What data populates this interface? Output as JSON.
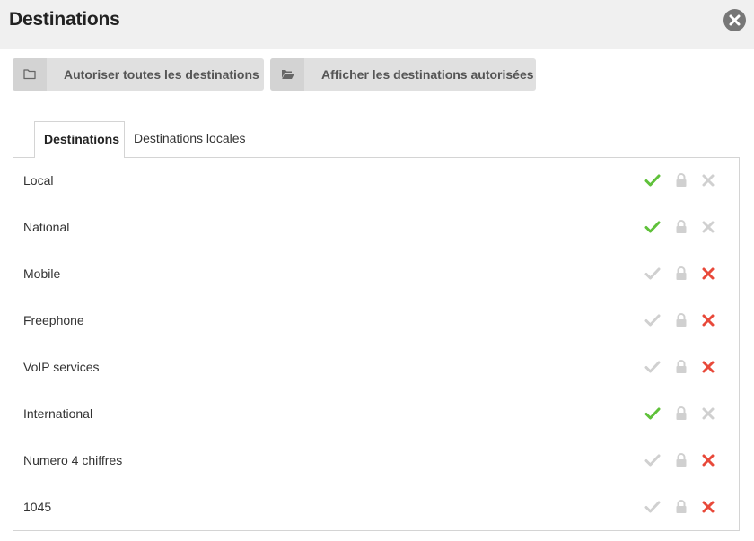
{
  "header": {
    "title": "Destinations"
  },
  "toolbar": {
    "allow_all_label": "Autoriser toutes les destinations",
    "show_allowed_label": "Afficher les destinations autorisées"
  },
  "tabs": [
    {
      "label": "Destinations",
      "active": true
    },
    {
      "label": "Destinations locales",
      "active": false
    }
  ],
  "colors": {
    "allowed_green": "#5fc13a",
    "blocked_red": "#e8493a",
    "inactive_gray": "#d0d0d0"
  },
  "destinations": [
    {
      "label": "Local",
      "status": "allowed"
    },
    {
      "label": "National",
      "status": "allowed"
    },
    {
      "label": "Mobile",
      "status": "blocked"
    },
    {
      "label": "Freephone",
      "status": "blocked"
    },
    {
      "label": "VoIP services",
      "status": "blocked"
    },
    {
      "label": "International",
      "status": "allowed"
    },
    {
      "label": "Numero 4 chiffres",
      "status": "blocked"
    },
    {
      "label": "1045",
      "status": "blocked"
    }
  ]
}
